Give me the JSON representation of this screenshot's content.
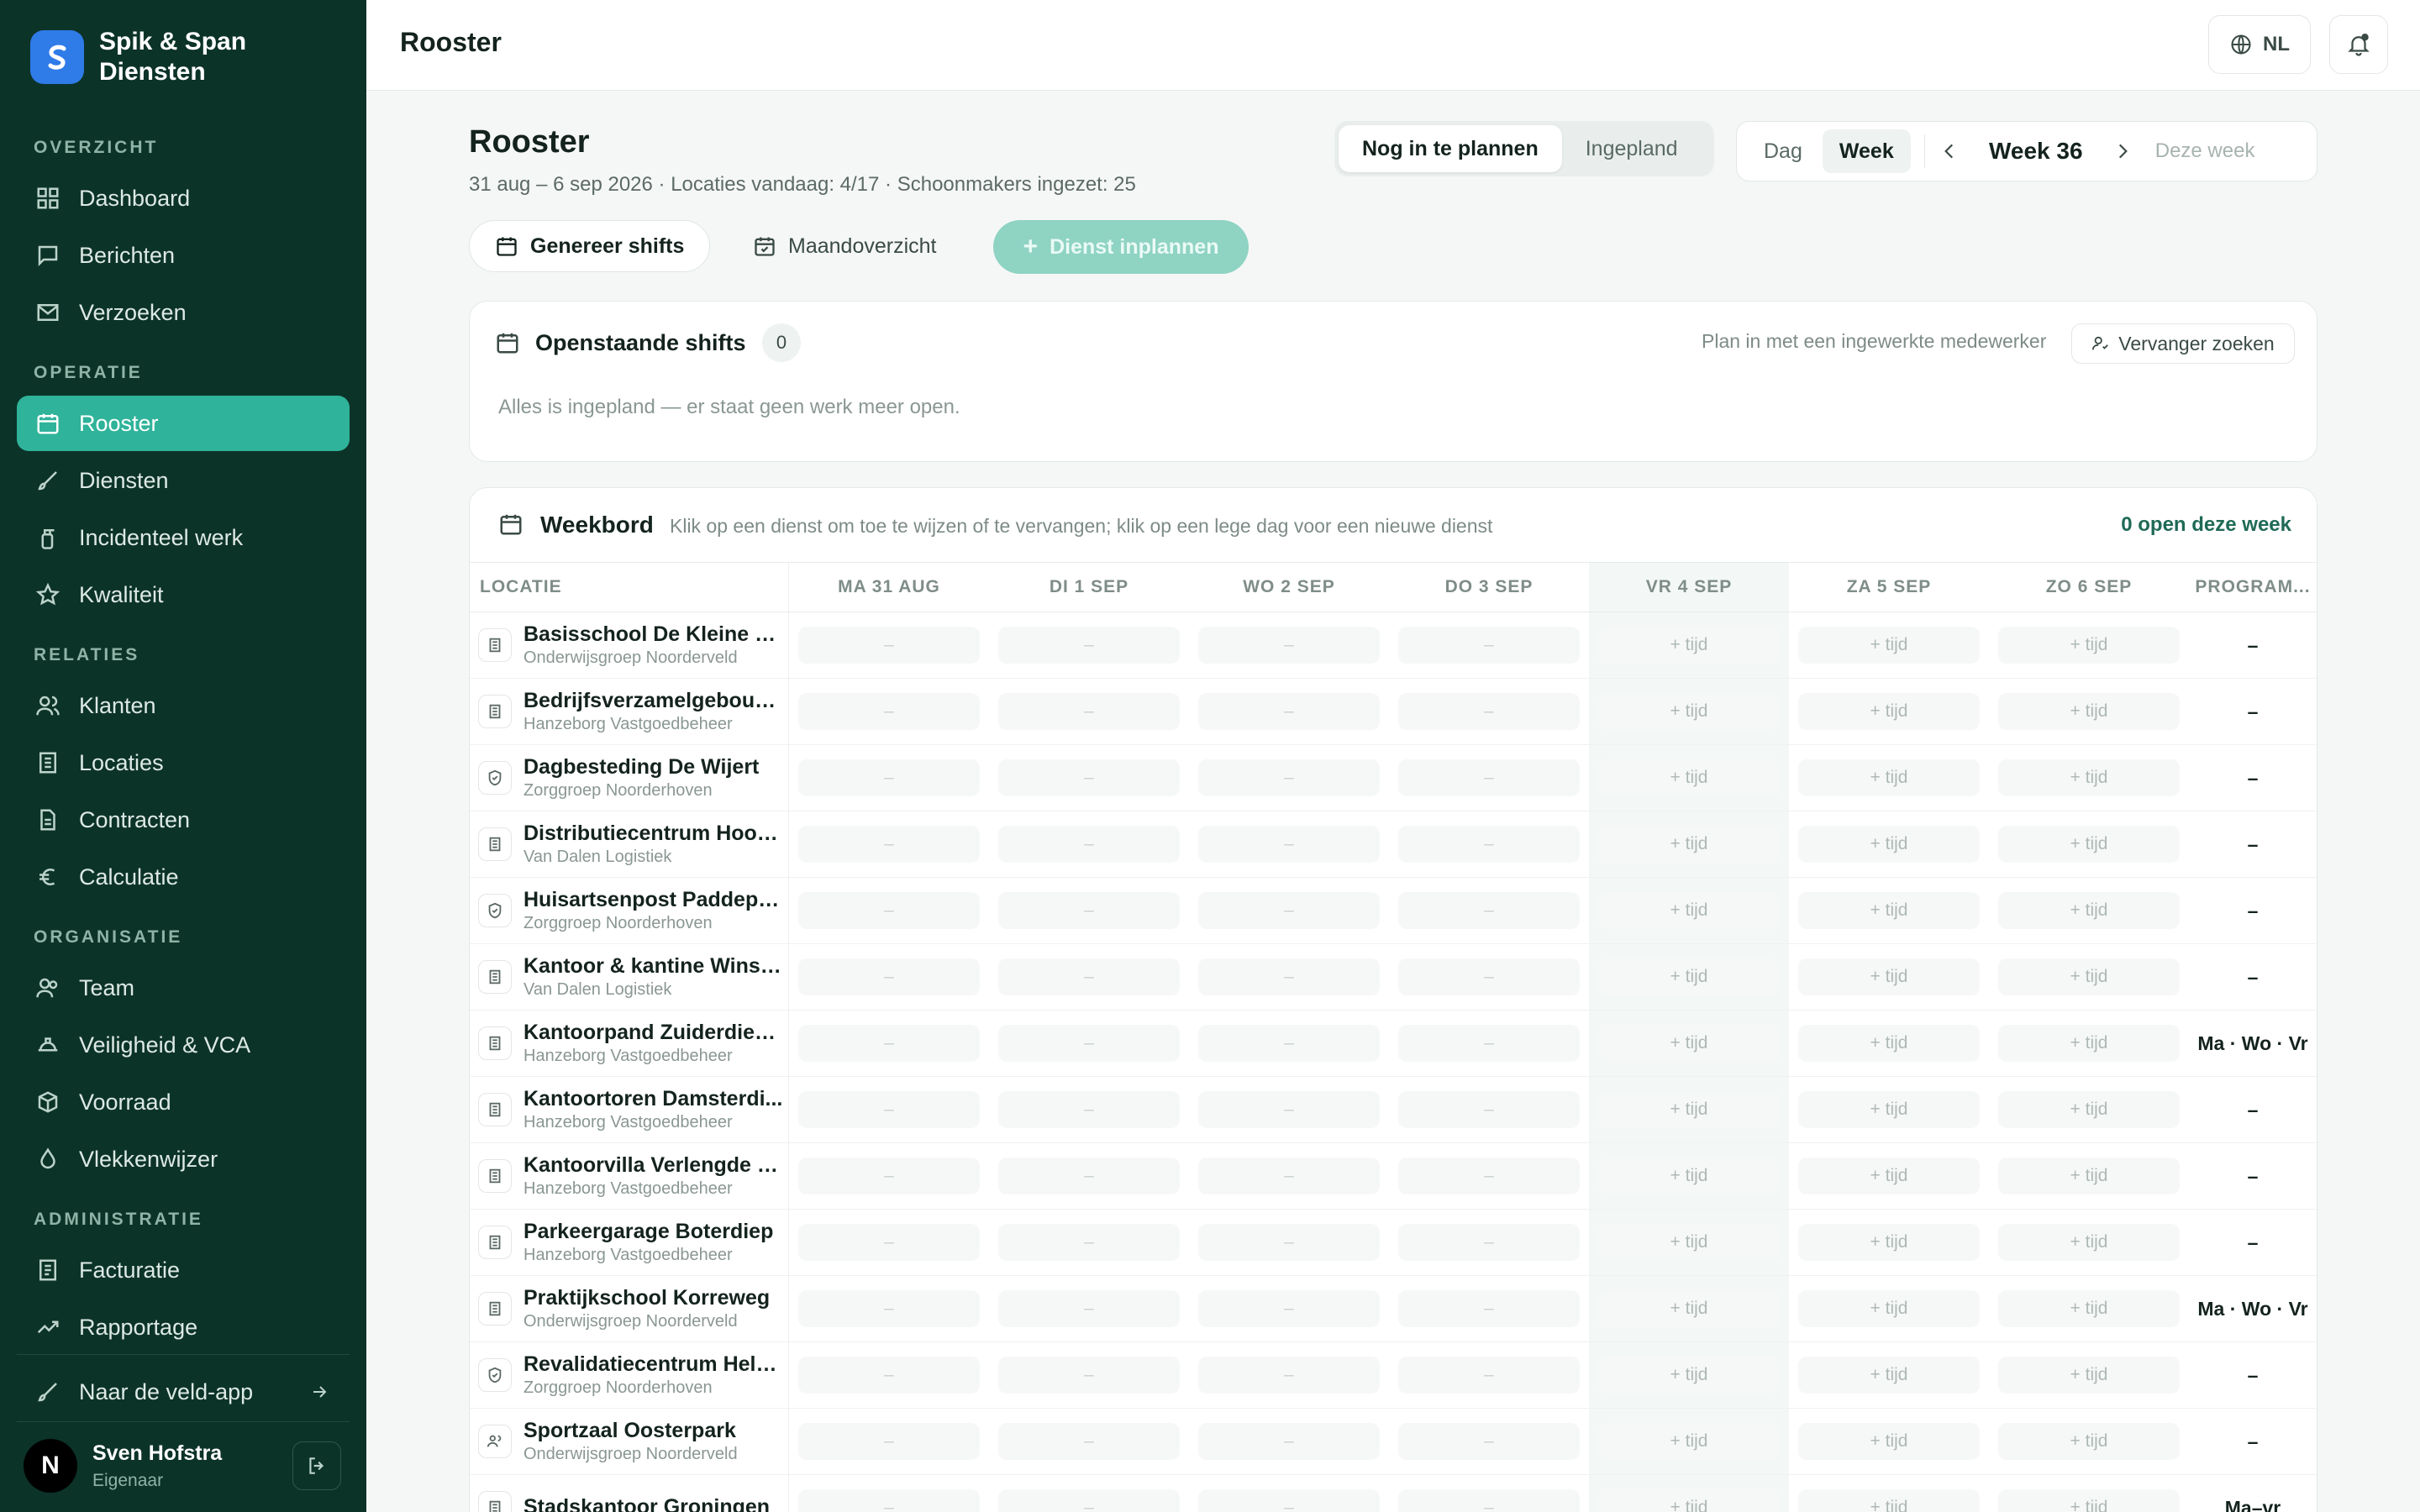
{
  "brand": {
    "line1": "Spik & Span",
    "line2": "Diensten"
  },
  "sidebar": {
    "sections": [
      {
        "label": "OVERZICHT",
        "items": [
          {
            "label": "Dashboard",
            "icon": "grid-icon"
          },
          {
            "label": "Berichten",
            "icon": "message-icon"
          },
          {
            "label": "Verzoeken",
            "icon": "mail-icon"
          }
        ]
      },
      {
        "label": "OPERATIE",
        "items": [
          {
            "label": "Rooster",
            "icon": "calendar-icon",
            "active": true
          },
          {
            "label": "Diensten",
            "icon": "brush-icon"
          },
          {
            "label": "Incidenteel werk",
            "icon": "spray-icon"
          },
          {
            "label": "Kwaliteit",
            "icon": "star-icon"
          }
        ]
      },
      {
        "label": "RELATIES",
        "items": [
          {
            "label": "Klanten",
            "icon": "users-icon"
          },
          {
            "label": "Locaties",
            "icon": "building-icon"
          },
          {
            "label": "Contracten",
            "icon": "file-icon"
          },
          {
            "label": "Calculatie",
            "icon": "euro-icon"
          }
        ]
      },
      {
        "label": "ORGANISATIE",
        "items": [
          {
            "label": "Team",
            "icon": "team-icon"
          },
          {
            "label": "Veiligheid & VCA",
            "icon": "helmet-icon"
          },
          {
            "label": "Voorraad",
            "icon": "box-icon"
          },
          {
            "label": "Vlekkenwijzer",
            "icon": "drop-icon"
          }
        ]
      },
      {
        "label": "ADMINISTRATIE",
        "items": [
          {
            "label": "Facturatie",
            "icon": "invoice-icon"
          },
          {
            "label": "Rapportage",
            "icon": "trend-icon"
          }
        ]
      }
    ],
    "field_app": "Naar de veld-app",
    "user": {
      "initial": "N",
      "name": "Sven Hofstra",
      "role": "Eigenaar"
    }
  },
  "topbar": {
    "title": "Rooster",
    "lang": "NL"
  },
  "header": {
    "title": "Rooster",
    "subtitle": "31 aug – 6 sep 2026 · Locaties vandaag: 4/17 · Schoonmakers ingezet: 25",
    "seg": [
      "Nog in te plannen",
      "Ingepland"
    ],
    "view": [
      "Dag",
      "Week"
    ],
    "week": "Week 36",
    "today": "Deze week",
    "actions": {
      "generate": "Genereer shifts",
      "month": "Maandoverzicht",
      "plan": "Dienst inplannen"
    }
  },
  "open_shifts": {
    "title": "Openstaande shifts",
    "count": "0",
    "hint": "Plan in met een ingewerkte medewerker",
    "button": "Vervanger zoeken",
    "empty": "Alles is ingepland — er staat geen werk meer open."
  },
  "weekboard": {
    "title": "Weekbord",
    "hint": "Klik op een dienst om toe te wijzen of te vervangen; klik op een lege dag voor een nieuwe dienst",
    "open": "0 open deze week",
    "columns": [
      "LOCATIE",
      "MA 31 AUG",
      "DI 1 SEP",
      "WO 2 SEP",
      "DO 3 SEP",
      "VR 4 SEP",
      "ZA 5 SEP",
      "ZO 6 SEP",
      "PROGRAM..."
    ],
    "dash": "–",
    "add": "+ tijd",
    "rows": [
      {
        "name": "Basisschool De Kleine W...",
        "client": "Onderwijsgroep Noorderveld",
        "prog": "–"
      },
      {
        "name": "Bedrijfsverzamelgebouw...",
        "client": "Hanzeborg Vastgoedbeheer",
        "prog": "–"
      },
      {
        "name": "Dagbesteding De Wijert",
        "client": "Zorggroep Noorderhoven",
        "prog": "–"
      },
      {
        "name": "Distributiecentrum Hoog...",
        "client": "Van Dalen Logistiek",
        "prog": "–"
      },
      {
        "name": "Huisartsenpost Paddepoel",
        "client": "Zorggroep Noorderhoven",
        "prog": "–"
      },
      {
        "name": "Kantoor & kantine Winsc...",
        "client": "Van Dalen Logistiek",
        "prog": "–"
      },
      {
        "name": "Kantoorpand Zuiderdiep ...",
        "client": "Hanzeborg Vastgoedbeheer",
        "prog": "Ma · Wo · Vr"
      },
      {
        "name": "Kantoortoren Damsterdi...",
        "client": "Hanzeborg Vastgoedbeheer",
        "prog": "–"
      },
      {
        "name": "Kantoorvilla Verlengde H...",
        "client": "Hanzeborg Vastgoedbeheer",
        "prog": "–"
      },
      {
        "name": "Parkeergarage Boterdiep",
        "client": "Hanzeborg Vastgoedbeheer",
        "prog": "–"
      },
      {
        "name": "Praktijkschool Korreweg",
        "client": "Onderwijsgroep Noorderveld",
        "prog": "Ma · Wo · Vr"
      },
      {
        "name": "Revalidatiecentrum Help...",
        "client": "Zorggroep Noorderhoven",
        "prog": "–"
      },
      {
        "name": "Sportzaal Oosterpark",
        "client": "Onderwijsgroep Noorderveld",
        "prog": "–"
      },
      {
        "name": "Stadskantoor Groningen",
        "client": "",
        "prog": "Ma–vr"
      }
    ]
  }
}
